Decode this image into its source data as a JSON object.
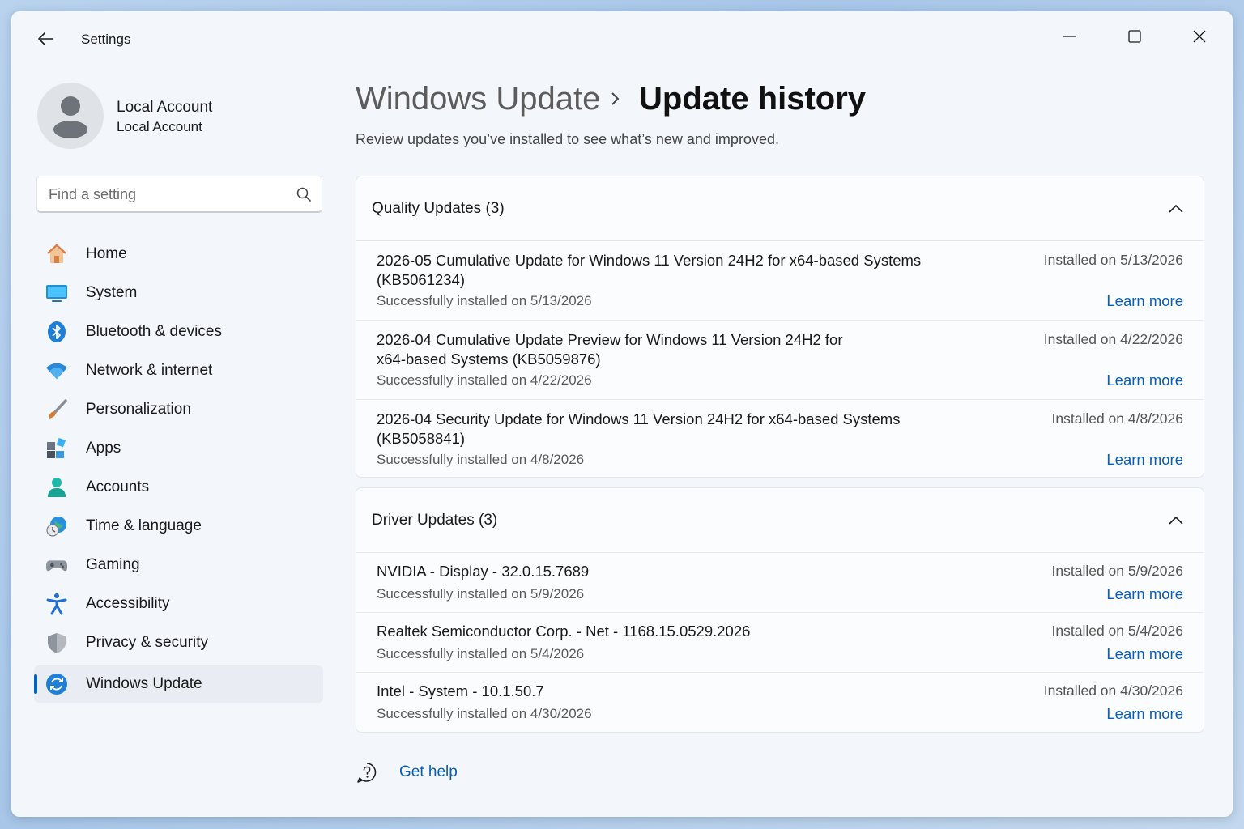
{
  "window": {
    "title": "Settings"
  },
  "profile": {
    "name": "Local Account",
    "subtitle": "Local Account"
  },
  "search": {
    "placeholder": "Find a setting"
  },
  "nav": {
    "items": [
      {
        "label": "Home",
        "icon": "home-icon"
      },
      {
        "label": "System",
        "icon": "system-icon"
      },
      {
        "label": "Bluetooth & devices",
        "icon": "bluetooth-icon"
      },
      {
        "label": "Network & internet",
        "icon": "wifi-icon"
      },
      {
        "label": "Personalization",
        "icon": "brush-icon"
      },
      {
        "label": "Apps",
        "icon": "apps-icon"
      },
      {
        "label": "Accounts",
        "icon": "accounts-icon"
      },
      {
        "label": "Time & language",
        "icon": "globe-clock-icon"
      },
      {
        "label": "Gaming",
        "icon": "gamepad-icon"
      },
      {
        "label": "Accessibility",
        "icon": "accessibility-icon"
      },
      {
        "label": "Privacy & security",
        "icon": "shield-icon"
      },
      {
        "label": "Windows Update",
        "icon": "update-icon",
        "active": true
      }
    ]
  },
  "header": {
    "parent": "Windows Update",
    "current": "Update history",
    "subtitle": "Review updates you’ve installed to see what’s new and improved."
  },
  "quality": {
    "title": "Quality Updates (3)",
    "items": [
      {
        "name": "2026-05 Cumulative Update for Windows 11 Version 24H2 for x64-based Systems (KB5061234)",
        "status": "Successfully installed on 5/13/2026",
        "date": "Installed on 5/13/2026",
        "link": "Learn more"
      },
      {
        "name": "2026-04 Cumulative Update Preview for Windows 11 Version 24H2 for x64-based Systems (KB5059876)",
        "status": "Successfully installed on 4/22/2026",
        "date": "Installed on 4/22/2026",
        "link": "Learn more"
      },
      {
        "name": "2026-04 Security Update for Windows 11 Version 24H2 for x64-based Systems (KB5058841)",
        "status": "Successfully installed on 4/8/2026",
        "date": "Installed on 4/8/2026",
        "link": "Learn more"
      }
    ]
  },
  "driver": {
    "title": "Driver Updates (3)",
    "items": [
      {
        "name": "NVIDIA - Display - 32.0.15.7689",
        "status": "Successfully installed on 5/9/2026",
        "date": "Installed on 5/9/2026",
        "link": "Learn more"
      },
      {
        "name": "Realtek Semiconductor Corp. - Net - 1168.15.0529.2026",
        "status": "Successfully installed on 5/4/2026",
        "date": "Installed on 5/4/2026",
        "link": "Learn more"
      },
      {
        "name": "Intel - System - 10.1.50.7",
        "status": "Successfully installed on 4/30/2026",
        "date": "Installed on 4/30/2026",
        "link": "Learn more"
      }
    ]
  },
  "help": {
    "label": "Get help"
  },
  "colors": {
    "accent": "#0067c0",
    "link": "#0a5fb4",
    "background": "#f3f6fb"
  }
}
